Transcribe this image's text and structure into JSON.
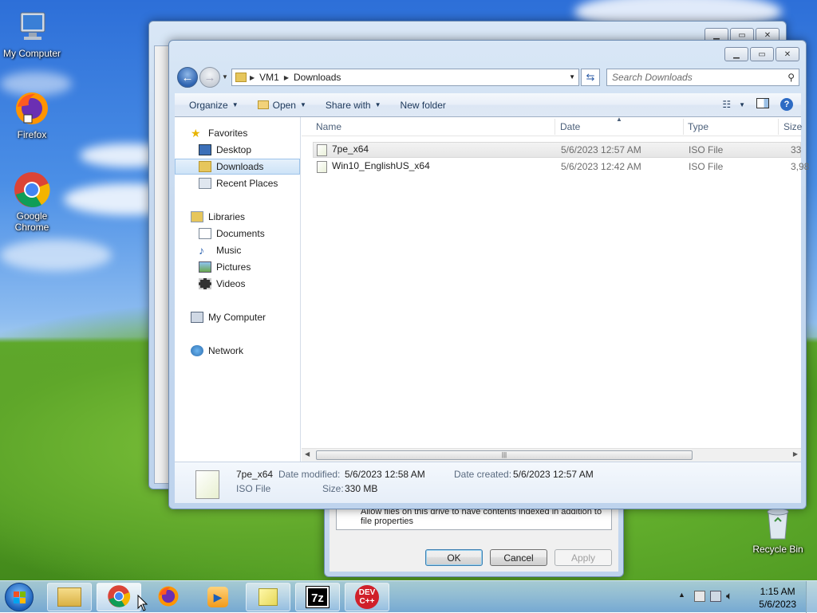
{
  "desktop": {
    "icons": [
      {
        "label": "My Computer",
        "icon": "computer-icon"
      },
      {
        "label": "Firefox",
        "icon": "firefox-icon"
      },
      {
        "label": "Google Chrome",
        "icon": "chrome-icon"
      },
      {
        "label": "Recycle Bin",
        "icon": "recycle-bin-icon"
      }
    ]
  },
  "props_dialog": {
    "text": "Allow files on this drive to have contents indexed in addition to file properties",
    "ok_label": "OK",
    "cancel_label": "Cancel",
    "apply_label": "Apply"
  },
  "explorer": {
    "breadcrumb": [
      "VM1",
      "Downloads"
    ],
    "search_placeholder": "Search Downloads",
    "toolbar": {
      "organize": "Organize",
      "open": "Open",
      "share_with": "Share with",
      "new_folder": "New folder"
    },
    "nav": {
      "favorites": "Favorites",
      "desktop": "Desktop",
      "downloads": "Downloads",
      "recent_places": "Recent Places",
      "libraries": "Libraries",
      "documents": "Documents",
      "music": "Music",
      "pictures": "Pictures",
      "videos": "Videos",
      "my_computer": "My Computer",
      "network": "Network"
    },
    "columns": {
      "name": "Name",
      "date": "Date",
      "type": "Type",
      "size": "Size"
    },
    "files": [
      {
        "name": "7pe_x64",
        "date": "5/6/2023 12:57 AM",
        "type": "ISO File",
        "size": "33"
      },
      {
        "name": "Win10_EnglishUS_x64",
        "date": "5/6/2023 12:42 AM",
        "type": "ISO File",
        "size": "3,98"
      }
    ],
    "details": {
      "name": "7pe_x64",
      "type": "ISO File",
      "date_modified_label": "Date modified:",
      "date_modified": "5/6/2023 12:58 AM",
      "size_label": "Size:",
      "size": "330 MB",
      "date_created_label": "Date created:",
      "date_created": "5/6/2023 12:57 AM"
    }
  },
  "taskbar": {
    "apps": [
      "windows-explorer-icon",
      "chrome-icon",
      "firefox-icon",
      "media-player-icon",
      "sticky-notes-icon",
      "7zip-icon",
      "devcpp-icon"
    ],
    "seven_zip_label": "7z",
    "devcpp_label": "DEV C++",
    "time": "1:15 AM",
    "date": "5/6/2023"
  },
  "colors": {
    "accent": "#2e63b0",
    "selection": "#cde3f7"
  }
}
